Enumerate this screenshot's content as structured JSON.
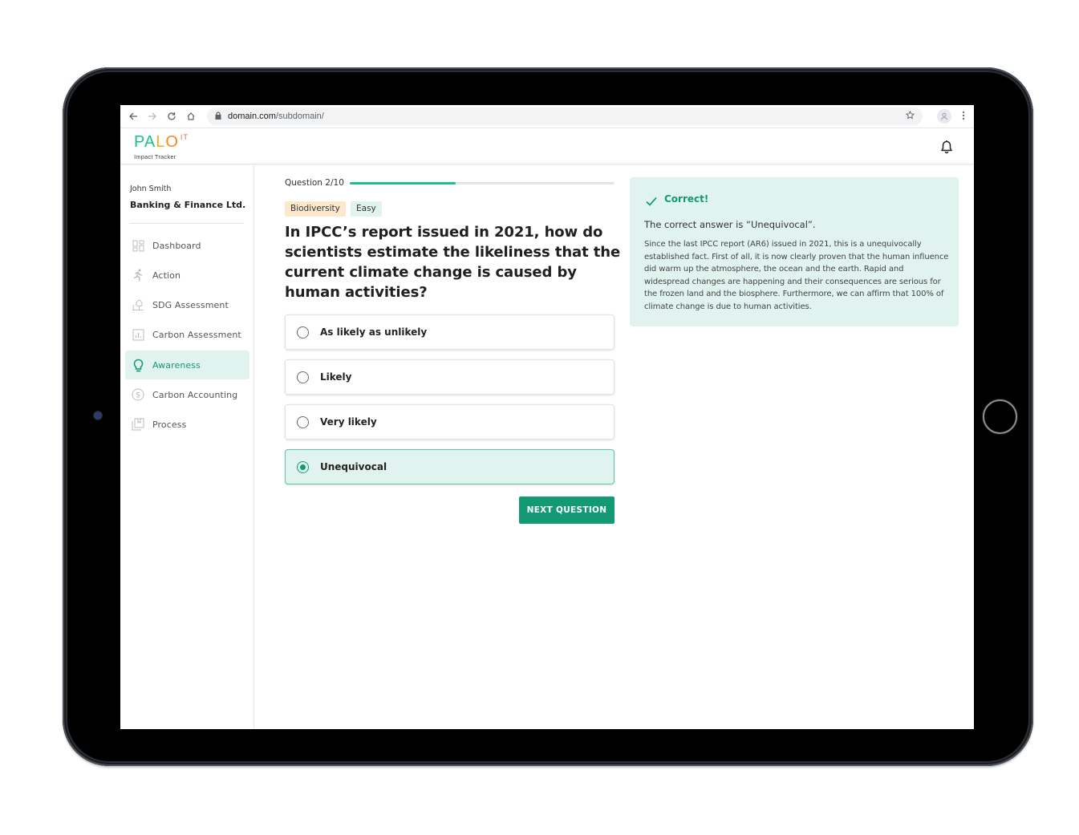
{
  "browser": {
    "url_host": "domain.com",
    "url_path": "/subdomain/",
    "icons": [
      "back-arrow-icon",
      "forward-arrow-icon",
      "reload-icon",
      "home-icon",
      "lock-icon",
      "star-icon",
      "profile-icon",
      "kebab-menu-icon"
    ]
  },
  "header": {
    "logo_pa": "PA",
    "logo_l": "L",
    "logo_o": "O",
    "logo_it": "IT",
    "logo_subtitle": "Impact Tracker",
    "notification_icon": "bell-icon"
  },
  "sidebar": {
    "user_name": "John Smith",
    "org_name": "Banking & Finance Ltd.",
    "items": [
      {
        "label": "Dashboard",
        "icon": "dashboard-icon",
        "active": false
      },
      {
        "label": "Action",
        "icon": "running-person-icon",
        "active": false
      },
      {
        "label": "SDG Assessment",
        "icon": "tree-icon",
        "active": false
      },
      {
        "label": "Carbon Assessment",
        "icon": "bar-chart-icon",
        "active": false
      },
      {
        "label": "Awareness",
        "icon": "lightbulb-icon",
        "active": true
      },
      {
        "label": "Carbon Accounting",
        "icon": "dollar-circle-icon",
        "active": false
      },
      {
        "label": "Process",
        "icon": "bookmark-stack-icon",
        "active": false
      }
    ]
  },
  "quiz": {
    "counter": "Question 2/10",
    "progress_percent": 40,
    "tags": {
      "topic": "Biodiversity",
      "level": "Easy"
    },
    "question": "In IPCC’s report issued in 2021, how do scientists estimate the likeliness that the current climate change is caused by human activities?",
    "options": [
      {
        "label": "As likely as unlikely",
        "selected": false
      },
      {
        "label": "Likely",
        "selected": false
      },
      {
        "label": "Very likely",
        "selected": false
      },
      {
        "label": "Unequivocal",
        "selected": true
      }
    ],
    "next_label": "NEXT QUESTION"
  },
  "feedback": {
    "status": "Correct!",
    "answer_line": "The correct answer is “Unequivocal”.",
    "explanation": "Since the last IPCC report (AR6) issued in 2021, this is a unequivocally established fact. First of all, it is now clearly proven that the human influence did warm up the atmosphere, the ocean and the earth. Rapid and widespread changes are happening and their consequences are serious for the frozen land and the biosphere. Furthermore, we can affirm that 100% of climate change is due to human activities."
  },
  "colors": {
    "brand_green": "#139a74",
    "progress_green": "#19c28e",
    "active_bg": "#e0f3ee",
    "topic_tag_bg": "#fde8cc"
  }
}
